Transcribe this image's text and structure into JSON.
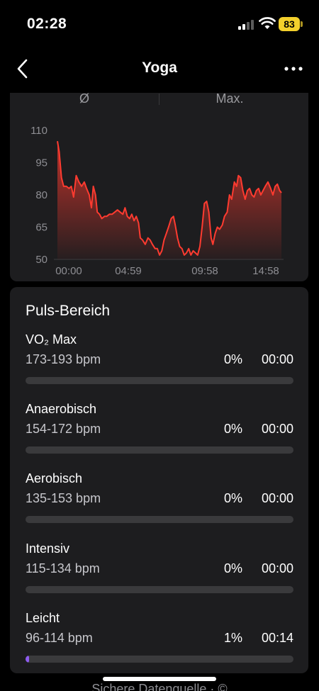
{
  "status_bar": {
    "time": "02:28",
    "battery": "83"
  },
  "nav": {
    "title": "Yoga"
  },
  "chart_header": {
    "avg_label": "Ø",
    "max_label": "Max."
  },
  "chart_data": {
    "type": "area",
    "title": "",
    "xlabel": "",
    "ylabel": "",
    "y_ticks": [
      "110",
      "95",
      "80",
      "65",
      "50"
    ],
    "x_ticks": [
      "00:00",
      "04:59",
      "09:58",
      "14:58"
    ],
    "ylim": [
      50,
      110
    ],
    "xlim": [
      0,
      1000
    ],
    "grid": false,
    "color": "#ff3b30",
    "series": [
      {
        "name": "",
        "points": [
          [
            0,
            105
          ],
          [
            8,
            100
          ],
          [
            18,
            88
          ],
          [
            28,
            84
          ],
          [
            40,
            84
          ],
          [
            52,
            83
          ],
          [
            62,
            84
          ],
          [
            72,
            79
          ],
          [
            84,
            89
          ],
          [
            96,
            86
          ],
          [
            108,
            84
          ],
          [
            120,
            86
          ],
          [
            130,
            83
          ],
          [
            142,
            80
          ],
          [
            152,
            74
          ],
          [
            160,
            84
          ],
          [
            170,
            80
          ],
          [
            178,
            72
          ],
          [
            188,
            71
          ],
          [
            198,
            69
          ],
          [
            210,
            70
          ],
          [
            220,
            70
          ],
          [
            232,
            71
          ],
          [
            244,
            71
          ],
          [
            256,
            72
          ],
          [
            268,
            73
          ],
          [
            280,
            72
          ],
          [
            292,
            71
          ],
          [
            302,
            74
          ],
          [
            312,
            70
          ],
          [
            322,
            69
          ],
          [
            332,
            71
          ],
          [
            342,
            68
          ],
          [
            352,
            70
          ],
          [
            362,
            67
          ],
          [
            370,
            60
          ],
          [
            380,
            59
          ],
          [
            392,
            57
          ],
          [
            404,
            60
          ],
          [
            414,
            59
          ],
          [
            424,
            57
          ],
          [
            436,
            55
          ],
          [
            446,
            55
          ],
          [
            456,
            52
          ],
          [
            466,
            54
          ],
          [
            476,
            59
          ],
          [
            486,
            62
          ],
          [
            496,
            65
          ],
          [
            508,
            69
          ],
          [
            518,
            70
          ],
          [
            526,
            66
          ],
          [
            536,
            60
          ],
          [
            546,
            56
          ],
          [
            556,
            55
          ],
          [
            566,
            52
          ],
          [
            576,
            53
          ],
          [
            586,
            55
          ],
          [
            596,
            52
          ],
          [
            606,
            54
          ],
          [
            616,
            53
          ],
          [
            626,
            52
          ],
          [
            636,
            56
          ],
          [
            646,
            65
          ],
          [
            656,
            76
          ],
          [
            666,
            77
          ],
          [
            676,
            72
          ],
          [
            686,
            60
          ],
          [
            694,
            57
          ],
          [
            704,
            62
          ],
          [
            714,
            65
          ],
          [
            724,
            64
          ],
          [
            736,
            66
          ],
          [
            746,
            70
          ],
          [
            758,
            72
          ],
          [
            768,
            80
          ],
          [
            778,
            78
          ],
          [
            790,
            86
          ],
          [
            800,
            84
          ],
          [
            808,
            89
          ],
          [
            818,
            88
          ],
          [
            828,
            82
          ],
          [
            838,
            78
          ],
          [
            848,
            82
          ],
          [
            858,
            83
          ],
          [
            868,
            80
          ],
          [
            878,
            79
          ],
          [
            888,
            82
          ],
          [
            898,
            83
          ],
          [
            908,
            80
          ],
          [
            918,
            82
          ],
          [
            928,
            84
          ],
          [
            940,
            86
          ],
          [
            952,
            83
          ],
          [
            962,
            80
          ],
          [
            972,
            84
          ],
          [
            982,
            85
          ],
          [
            992,
            82
          ],
          [
            1000,
            81
          ]
        ]
      }
    ]
  },
  "zones": {
    "title": "Puls-Bereich",
    "items": [
      {
        "name": "VO₂ Max",
        "range": "173-193 bpm",
        "percent": "0%",
        "time": "00:00",
        "fill": 0
      },
      {
        "name": "Anaerobisch",
        "range": "154-172 bpm",
        "percent": "0%",
        "time": "00:00",
        "fill": 0
      },
      {
        "name": "Aerobisch",
        "range": "135-153 bpm",
        "percent": "0%",
        "time": "00:00",
        "fill": 0
      },
      {
        "name": "Intensiv",
        "range": "115-134 bpm",
        "percent": "0%",
        "time": "00:00",
        "fill": 0
      },
      {
        "name": "Leicht",
        "range": "96-114 bpm",
        "percent": "1%",
        "time": "00:14",
        "fill": 0.01
      }
    ]
  },
  "bottom": {
    "text": "Sichere Datenquelle · ©"
  },
  "colors": {
    "accent": "#ff3b30",
    "zone_fill": "#8e5cf0",
    "battery": "#f3d02c"
  }
}
